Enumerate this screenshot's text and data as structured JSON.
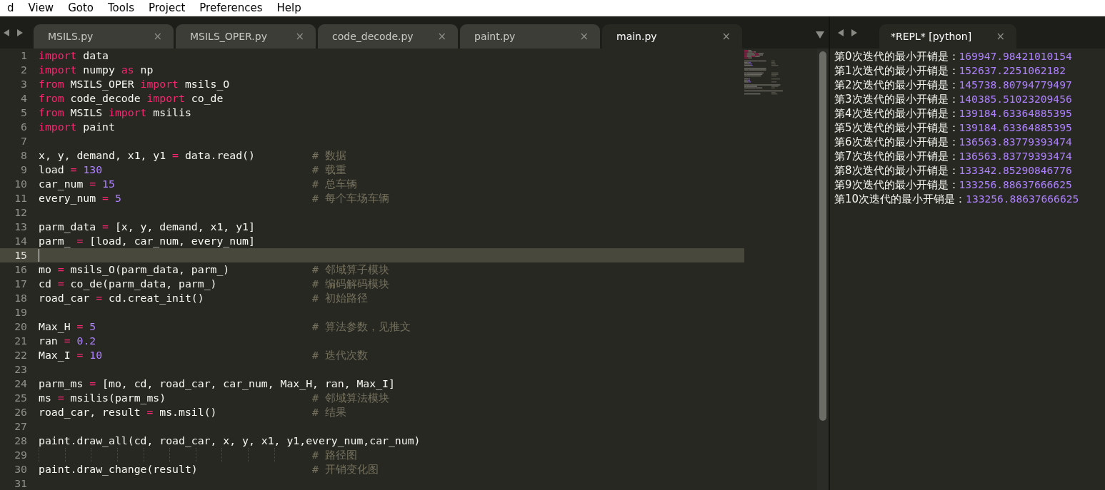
{
  "menu": [
    {
      "label": "d"
    },
    {
      "label": "View"
    },
    {
      "label": "Goto"
    },
    {
      "label": "Tools"
    },
    {
      "label": "Project"
    },
    {
      "label": "Preferences"
    },
    {
      "label": "Help"
    }
  ],
  "editor_tabs": [
    {
      "label": "MSILS.py",
      "close": "×",
      "selected": false
    },
    {
      "label": "MSILS_OPER.py",
      "close": "×",
      "selected": false
    },
    {
      "label": "code_decode.py",
      "close": "×",
      "selected": false
    },
    {
      "label": "paint.py",
      "close": "×",
      "selected": false
    },
    {
      "label": "main.py",
      "close": "×",
      "selected": true
    }
  ],
  "code": [
    {
      "number": "1",
      "current": false,
      "tokens": [
        {
          "kind": "keyword",
          "text": "import"
        },
        {
          "kind": "plain",
          "text": " data"
        }
      ]
    },
    {
      "number": "2",
      "current": false,
      "tokens": [
        {
          "kind": "keyword",
          "text": "import"
        },
        {
          "kind": "plain",
          "text": " numpy "
        },
        {
          "kind": "keyword",
          "text": "as"
        },
        {
          "kind": "plain",
          "text": " np"
        }
      ]
    },
    {
      "number": "3",
      "current": false,
      "tokens": [
        {
          "kind": "keyword",
          "text": "from"
        },
        {
          "kind": "plain",
          "text": " MSILS_OPER "
        },
        {
          "kind": "keyword",
          "text": "import"
        },
        {
          "kind": "plain",
          "text": " msils_O"
        }
      ]
    },
    {
      "number": "4",
      "current": false,
      "tokens": [
        {
          "kind": "keyword",
          "text": "from"
        },
        {
          "kind": "plain",
          "text": " code_decode "
        },
        {
          "kind": "keyword",
          "text": "import"
        },
        {
          "kind": "plain",
          "text": " co_de"
        }
      ]
    },
    {
      "number": "5",
      "current": false,
      "tokens": [
        {
          "kind": "keyword",
          "text": "from"
        },
        {
          "kind": "plain",
          "text": " MSILS "
        },
        {
          "kind": "keyword",
          "text": "import"
        },
        {
          "kind": "plain",
          "text": " msilis"
        }
      ]
    },
    {
      "number": "6",
      "current": false,
      "tokens": [
        {
          "kind": "keyword",
          "text": "import"
        },
        {
          "kind": "plain",
          "text": " paint"
        }
      ]
    },
    {
      "number": "7",
      "current": false
    },
    {
      "number": "8",
      "current": false,
      "tokens": [
        {
          "kind": "plain",
          "text": "x, y, demand, x1, y1 "
        },
        {
          "kind": "operator",
          "text": "="
        },
        {
          "kind": "plain",
          "text": " data.read()"
        }
      ],
      "comment": "# 数据"
    },
    {
      "number": "9",
      "current": false,
      "tokens": [
        {
          "kind": "plain",
          "text": "load "
        },
        {
          "kind": "operator",
          "text": "="
        },
        {
          "kind": "number",
          "text": " 130"
        }
      ],
      "comment": "# 载重"
    },
    {
      "number": "10",
      "current": false,
      "tokens": [
        {
          "kind": "plain",
          "text": "car_num "
        },
        {
          "kind": "operator",
          "text": "="
        },
        {
          "kind": "number",
          "text": " 15"
        }
      ],
      "comment": "# 总车辆"
    },
    {
      "number": "11",
      "current": false,
      "tokens": [
        {
          "kind": "plain",
          "text": "every_num "
        },
        {
          "kind": "operator",
          "text": "="
        },
        {
          "kind": "number",
          "text": " 5"
        }
      ],
      "comment": "# 每个车场车辆"
    },
    {
      "number": "12",
      "current": false
    },
    {
      "number": "13",
      "current": false,
      "tokens": [
        {
          "kind": "plain",
          "text": "parm_data "
        },
        {
          "kind": "operator",
          "text": "="
        },
        {
          "kind": "plain",
          "text": " [x, y, demand, x1, y1]"
        }
      ]
    },
    {
      "number": "14",
      "current": false,
      "tokens": [
        {
          "kind": "plain",
          "text": "parm_ "
        },
        {
          "kind": "operator",
          "text": "="
        },
        {
          "kind": "plain",
          "text": " [load, car_num, every_num]"
        }
      ]
    },
    {
      "number": "15",
      "current": true
    },
    {
      "number": "16",
      "current": false,
      "tokens": [
        {
          "kind": "plain",
          "text": "mo "
        },
        {
          "kind": "operator",
          "text": "="
        },
        {
          "kind": "plain",
          "text": " msils_O(parm_data, parm_)"
        }
      ],
      "comment": "# 邻域算子模块"
    },
    {
      "number": "17",
      "current": false,
      "tokens": [
        {
          "kind": "plain",
          "text": "cd "
        },
        {
          "kind": "operator",
          "text": "="
        },
        {
          "kind": "plain",
          "text": " co_de(parm_data, parm_)"
        }
      ],
      "comment": "# 编码解码模块"
    },
    {
      "number": "18",
      "current": false,
      "tokens": [
        {
          "kind": "plain",
          "text": "road_car "
        },
        {
          "kind": "operator",
          "text": "="
        },
        {
          "kind": "plain",
          "text": " cd.creat_init()"
        }
      ],
      "comment": "# 初始路径"
    },
    {
      "number": "19",
      "current": false
    },
    {
      "number": "20",
      "current": false,
      "tokens": [
        {
          "kind": "plain",
          "text": "Max_H "
        },
        {
          "kind": "operator",
          "text": "="
        },
        {
          "kind": "number",
          "text": " 5"
        }
      ],
      "comment": "# 算法参数，见推文"
    },
    {
      "number": "21",
      "current": false,
      "tokens": [
        {
          "kind": "plain",
          "text": "ran "
        },
        {
          "kind": "operator",
          "text": "="
        },
        {
          "kind": "number",
          "text": " 0.2"
        }
      ]
    },
    {
      "number": "22",
      "current": false,
      "tokens": [
        {
          "kind": "plain",
          "text": "Max_I "
        },
        {
          "kind": "operator",
          "text": "="
        },
        {
          "kind": "number",
          "text": " 10"
        }
      ],
      "comment": "# 迭代次数"
    },
    {
      "number": "23",
      "current": false
    },
    {
      "number": "24",
      "current": false,
      "tokens": [
        {
          "kind": "plain",
          "text": "parm_ms "
        },
        {
          "kind": "operator",
          "text": "="
        },
        {
          "kind": "plain",
          "text": " [mo, cd, road_car, car_num, Max_H, ran, Max_I]"
        }
      ]
    },
    {
      "number": "25",
      "current": false,
      "tokens": [
        {
          "kind": "plain",
          "text": "ms "
        },
        {
          "kind": "operator",
          "text": "="
        },
        {
          "kind": "plain",
          "text": " msilis(parm_ms)"
        }
      ],
      "comment": "# 邻域算法模块"
    },
    {
      "number": "26",
      "current": false,
      "tokens": [
        {
          "kind": "plain",
          "text": "road_car, result "
        },
        {
          "kind": "operator",
          "text": "="
        },
        {
          "kind": "plain",
          "text": " ms.msil()"
        }
      ],
      "comment": "# 结果"
    },
    {
      "number": "27",
      "current": false
    },
    {
      "number": "28",
      "current": false,
      "tokens": [
        {
          "kind": "plain",
          "text": "paint.draw_all(cd, road_car, x, y, x1, y1,every_num,car_num)"
        }
      ]
    },
    {
      "number": "29",
      "current": false,
      "comment": "# 路径图"
    },
    {
      "number": "30",
      "current": false,
      "tokens": [
        {
          "kind": "plain",
          "text": "paint.draw_change(result)"
        }
      ],
      "comment": "# 开销变化图"
    },
    {
      "number": "31",
      "current": false
    }
  ],
  "repl_tab": {
    "label": "*REPL* [python]",
    "close": "×"
  },
  "repl_output": [
    {
      "label": "第0次迭代的最小开销是：",
      "value": "169947.98421010154"
    },
    {
      "label": "第1次迭代的最小开销是：",
      "value": "152637.2251062182"
    },
    {
      "label": "第2次迭代的最小开销是：",
      "value": "145738.80794779497"
    },
    {
      "label": "第3次迭代的最小开销是：",
      "value": "140385.51023209456"
    },
    {
      "label": "第4次迭代的最小开销是：",
      "value": "139184.63364885395"
    },
    {
      "label": "第5次迭代的最小开销是：",
      "value": "139184.63364885395"
    },
    {
      "label": "第6次迭代的最小开销是：",
      "value": "136563.83779393474"
    },
    {
      "label": "第7次迭代的最小开销是：",
      "value": "136563.83779393474"
    },
    {
      "label": "第8次迭代的最小开销是：",
      "value": "133342.85290846776"
    },
    {
      "label": "第9次迭代的最小开销是：",
      "value": "133256.88637666625"
    },
    {
      "label": "第10次迭代的最小开销是：",
      "value": "133256.88637666625"
    }
  ]
}
